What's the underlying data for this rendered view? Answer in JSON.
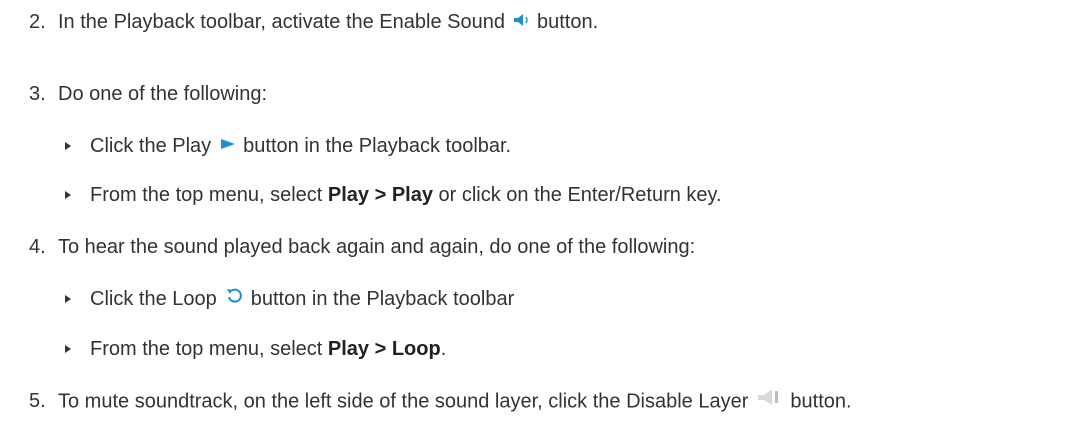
{
  "steps": {
    "s2": {
      "num": "2.",
      "pre": "In the Playback toolbar, activate the Enable Sound",
      "post": "button.",
      "icon": "speaker-icon"
    },
    "s3": {
      "num": "3.",
      "text": "Do one of the following:",
      "b1": {
        "pre": "Click the Play",
        "post": "button in the Playback toolbar.",
        "icon": "play-icon"
      },
      "b2": {
        "pre": "From the top menu, select ",
        "bold": "Play > Play",
        "post": " or click on the Enter/Return key."
      }
    },
    "s4": {
      "num": "4.",
      "text": "To hear the sound played back again and again, do one of the following:",
      "b1": {
        "pre": "Click the Loop",
        "post": "button in the Playback toolbar",
        "icon": "loop-icon"
      },
      "b2": {
        "pre": "From the top menu, select ",
        "bold": "Play > Loop",
        "post": "."
      }
    },
    "s5": {
      "num": "5.",
      "pre": "To mute soundtrack, on the left side of the sound layer, click the Disable Layer",
      "post": "button.",
      "icon": "disable-layer-icon"
    }
  },
  "colors": {
    "icon_blue": "#1a8fd6",
    "text": "#333333",
    "disabled_grey": "#d8d8d8"
  }
}
